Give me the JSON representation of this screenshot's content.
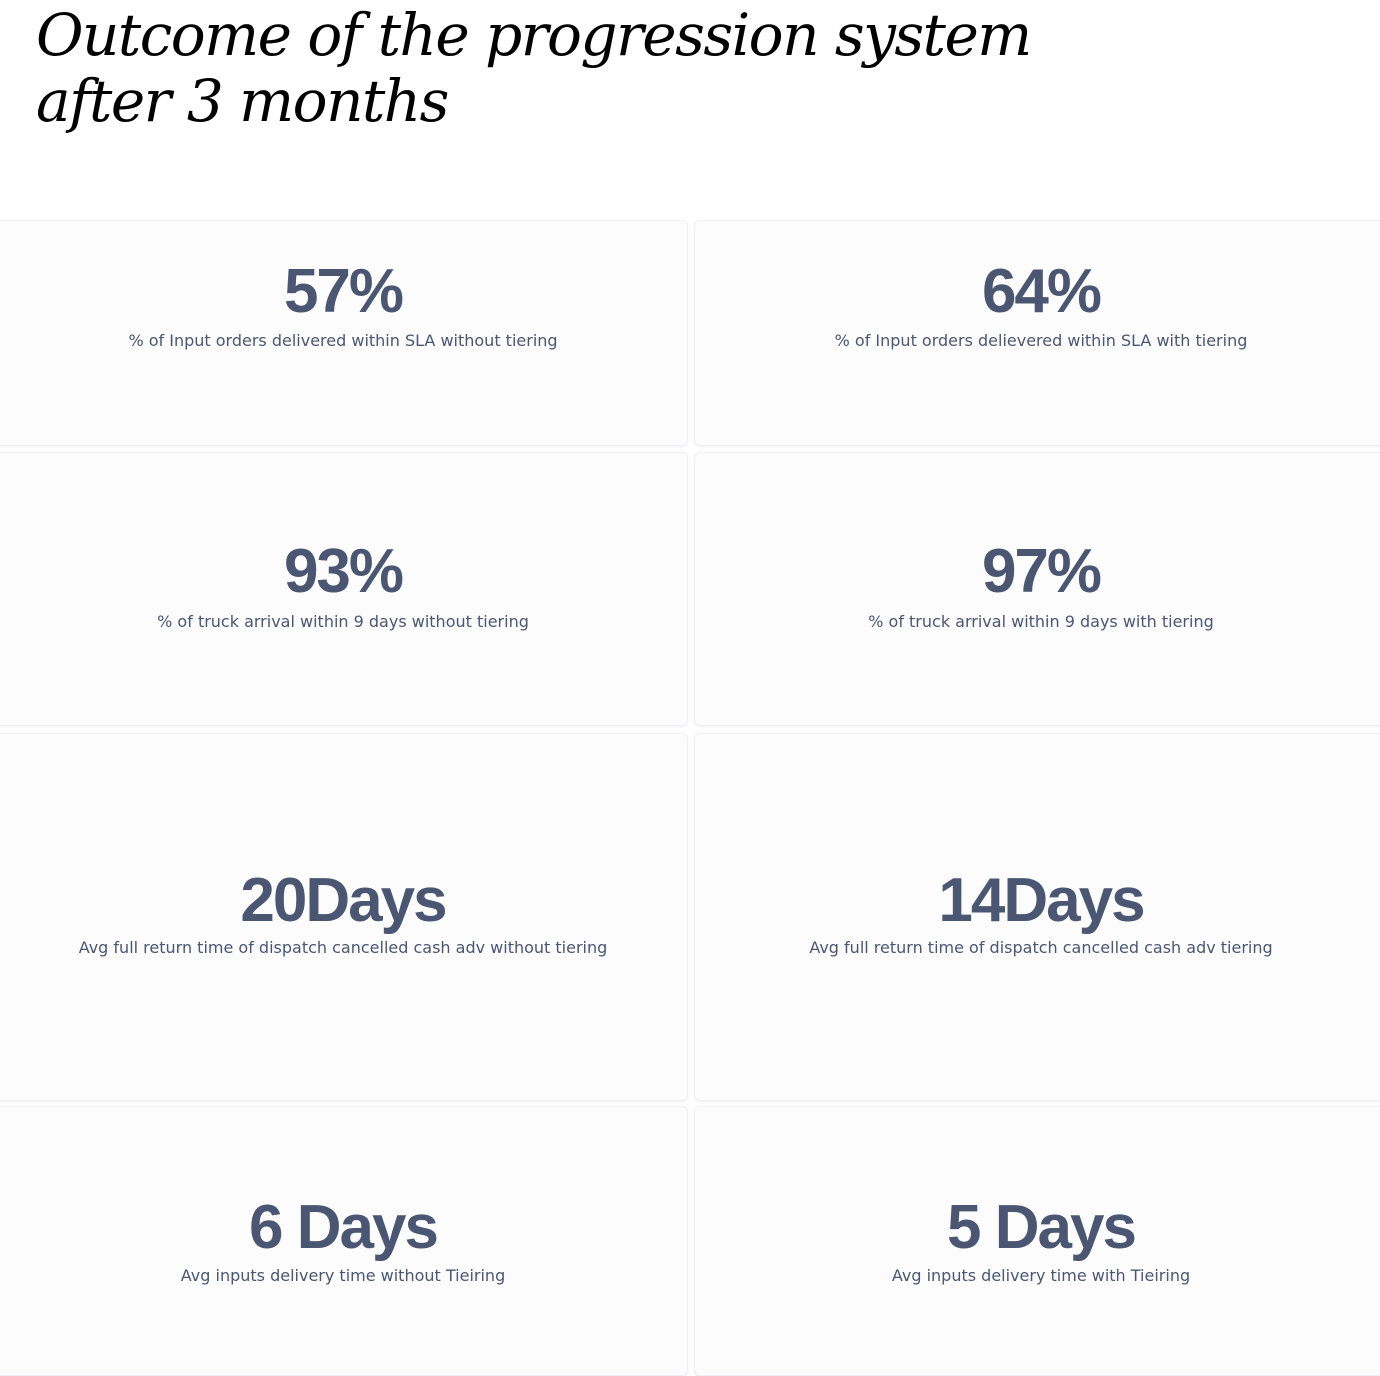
{
  "title": {
    "line1": "Outcome of the progression system",
    "line2": "after 3 months"
  },
  "cards": [
    {
      "value": "57%",
      "label": "% of Input orders delivered within SLA without tiering"
    },
    {
      "value": "64%",
      "label": "% of Input orders delievered within SLA with tiering"
    },
    {
      "value": "93%",
      "label": "% of truck arrival within 9 days without tiering"
    },
    {
      "value": "97%",
      "label": "% of truck arrival within 9 days with tiering"
    },
    {
      "value": "20Days",
      "label": "Avg full return time of dispatch cancelled cash adv without tiering"
    },
    {
      "value": "14Days",
      "label": "Avg full return time of dispatch cancelled cash adv tiering"
    },
    {
      "value": "6 Days",
      "label": "Avg inputs delivery time without Tieiring"
    },
    {
      "value": "5 Days",
      "label": "Avg inputs delivery time with Tieiring"
    }
  ],
  "colors": {
    "metric_text": "#4a5672",
    "card_background": "#fcfcfd",
    "title_text": "#000000"
  }
}
